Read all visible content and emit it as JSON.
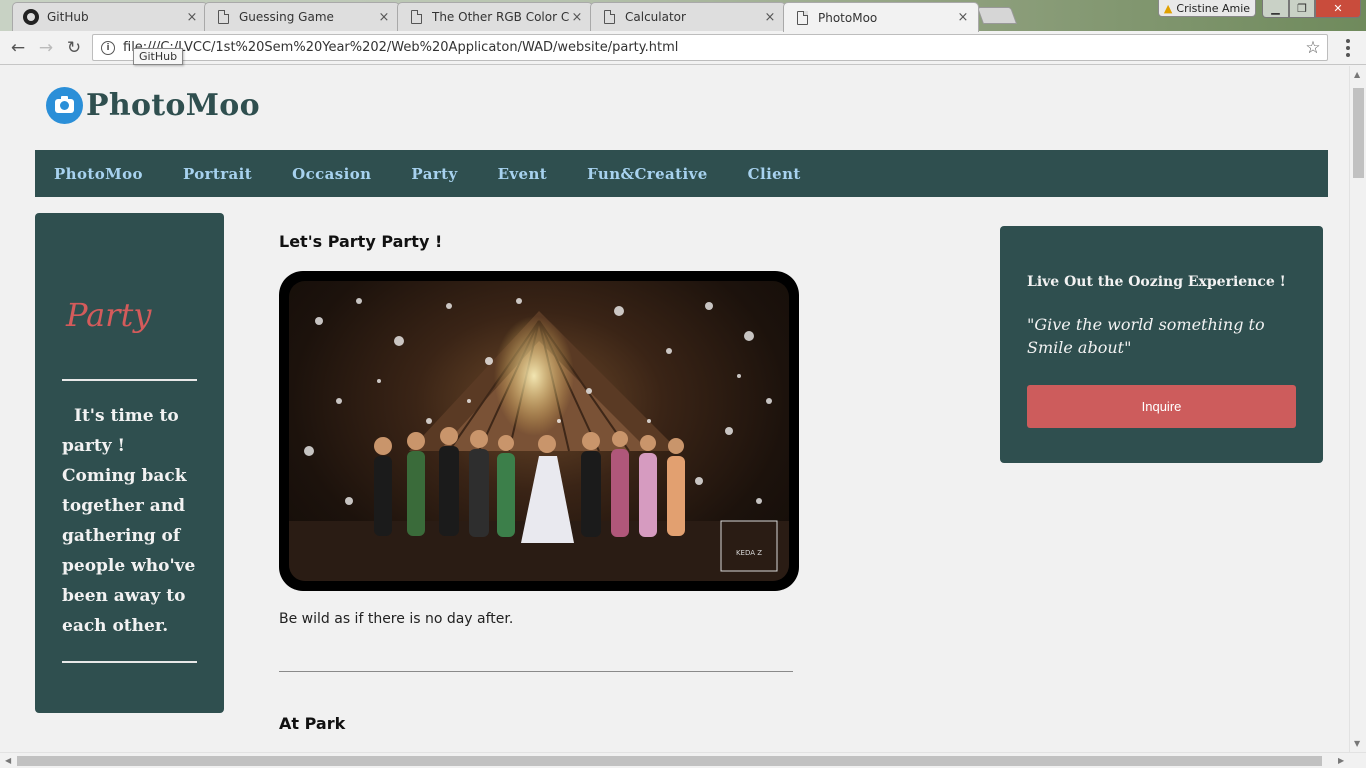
{
  "browser": {
    "tabs": [
      {
        "title": "GitHub",
        "icon": "github-icon",
        "active": false
      },
      {
        "title": "Guessing Game",
        "icon": "page-icon",
        "active": false
      },
      {
        "title": "The Other RGB Color Ch",
        "icon": "page-icon",
        "active": false
      },
      {
        "title": "Calculator",
        "icon": "page-icon",
        "active": false
      },
      {
        "title": "PhotoMoo",
        "icon": "page-icon",
        "active": true
      }
    ],
    "close_glyph": "×",
    "profile_name": "Cristine Amie",
    "url": "file:///C:/LVCC/1st%20Sem%20Year%202/Web%20Applicaton/WAD/website/party.html",
    "tooltip": "GitHub"
  },
  "site": {
    "logo_text": "PhotoMoo",
    "nav": [
      "PhotoMoo",
      "Portrait",
      "Occasion",
      "Party",
      "Event",
      "Fun&Creative",
      "Client"
    ]
  },
  "sidebar": {
    "title": "Party",
    "text": "It's time to party ! Coming back together and gathering of people who've been away to each other."
  },
  "main": {
    "heading": "Let's Party Party !",
    "photo_watermark": "KEDA Z",
    "caption": "Be wild as if there is no day after.",
    "subheading": "At Park"
  },
  "promo": {
    "title": "Live Out the Oozing Experience !",
    "quote": "\"Give the world something to Smile about\"",
    "button": "Inquire"
  },
  "colors": {
    "brand_dark": "#2f4f4f",
    "nav_link": "#a7d2ef",
    "accent_red": "#cd5c5c",
    "logo_blue": "#2b8fd8"
  }
}
